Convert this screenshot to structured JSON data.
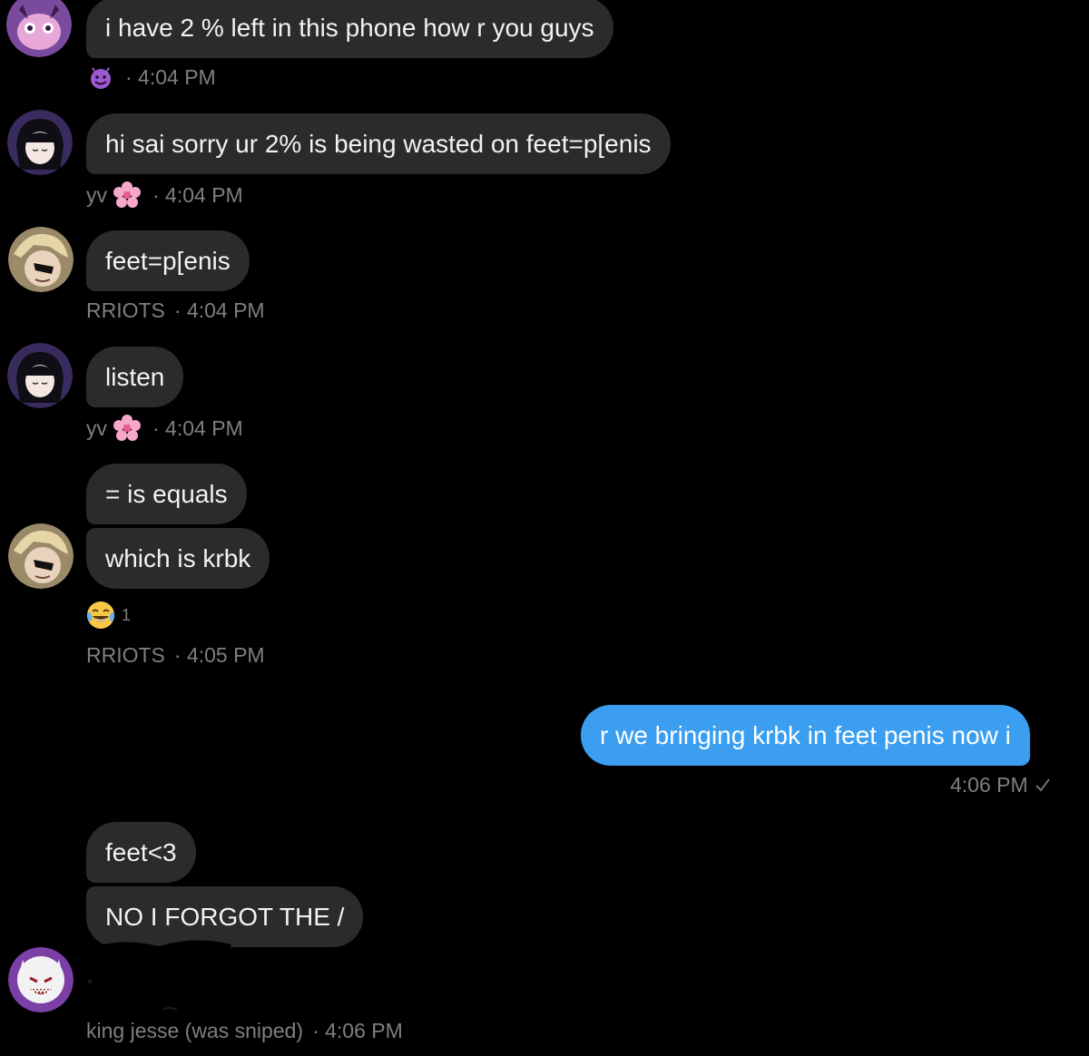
{
  "messages": [
    {
      "text": "i have 2 % left in this phone how r you guys"
    },
    {
      "text": "hi sai sorry ur 2% is being wasted on feet=p[enis"
    },
    {
      "text": "feet=p[enis"
    },
    {
      "text": "listen"
    },
    {
      "text": "= is equals"
    },
    {
      "text": "which is krbk"
    },
    {
      "text": "r we bringing krbk in feet penis now i"
    },
    {
      "text": "feet<3"
    },
    {
      "text": "NO I FORGOT THE /"
    }
  ],
  "meta": {
    "m1_time": "· 4:04 PM",
    "m2_name": "yv",
    "m2_time": "· 4:04 PM",
    "m3_name": "RRIOTS",
    "m3_time": "· 4:04 PM",
    "m4_name": "yv",
    "m4_time": "· 4:04 PM",
    "m6_name": "RRIOTS",
    "m6_time": "· 4:05 PM",
    "m7_time": "4:06 PM",
    "m9_name": "king jesse (was sniped)",
    "m9_time": "· 4:06 PM"
  },
  "reaction": {
    "emoji": "laughing-tears",
    "count": "1"
  },
  "icons": {
    "devil": "smiling-devil-emoji",
    "flower": "cherry-blossom-emoji",
    "check": "sent-check-icon"
  },
  "colors": {
    "background": "#000000",
    "bubble_other": "#2b2b2e",
    "bubble_mine": "#3b9ef0",
    "meta_text": "#7e7e84"
  }
}
